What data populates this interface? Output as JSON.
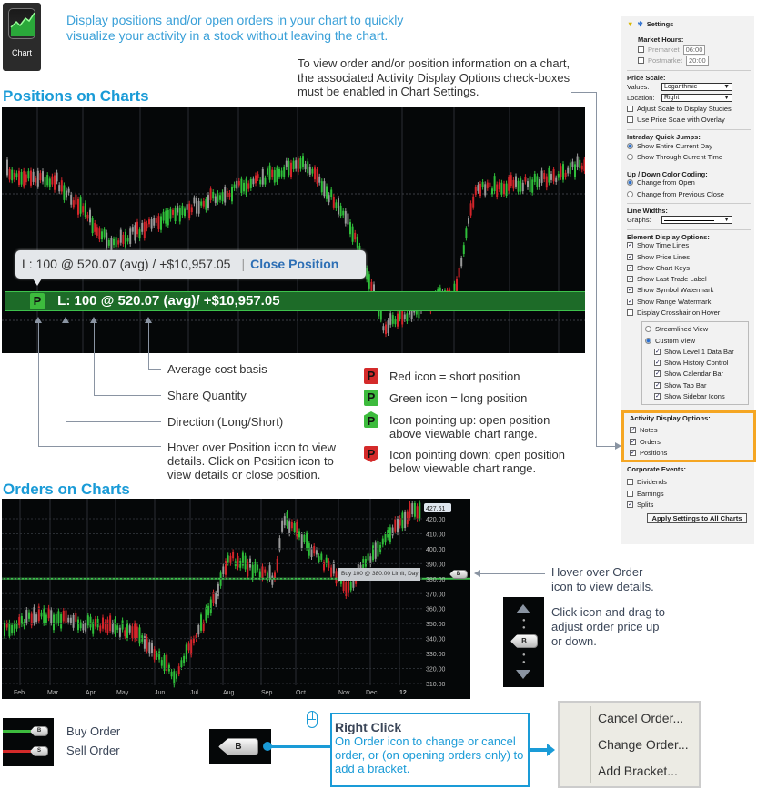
{
  "app_icon": {
    "label": "Chart"
  },
  "intro": "Display positions and/or open orders in your chart to quickly visualize your activity in a stock without leaving the chart.",
  "note": "To view order and/or position information on a chart, the associated Activity Display Options check-boxes must be enabled in Chart Settings.",
  "positions": {
    "title": "Positions on Charts",
    "tooltip": {
      "text": "L: 100 @ 520.07 (avg) / +$10,957.05",
      "separator": "|",
      "close": "Close Position"
    },
    "bar": {
      "icon": "P",
      "text": "L: 100  @ 520.07 (avg)/ +$10,957.05"
    },
    "callouts": [
      "Average cost basis",
      "Share Quantity",
      "Direction (Long/Short)",
      "Hover over Position icon to view details. Click on Position icon to view details or close position."
    ],
    "legend": [
      {
        "icon": "P",
        "color": "#d42a2a",
        "shape": "square",
        "text": "Red icon = short position"
      },
      {
        "icon": "P",
        "color": "#3dbb3d",
        "shape": "square",
        "text": "Green icon = long position"
      },
      {
        "icon": "P",
        "color": "#3dbb3d",
        "shape": "up",
        "text": "Icon pointing up: open  position above viewable chart range."
      },
      {
        "icon": "P",
        "color": "#d42a2a",
        "shape": "down",
        "text": "Icon pointing down: open position below viewable chart range."
      }
    ]
  },
  "orders": {
    "title": "Orders on Charts",
    "price_labels": [
      "427.61",
      "420.00",
      "410.00",
      "400.00",
      "390.00",
      "380.00",
      "370.00",
      "360.00",
      "350.00",
      "340.00",
      "330.00",
      "320.00",
      "310.00"
    ],
    "months": [
      "Feb",
      "Mar",
      "Apr",
      "May",
      "Jun",
      "Jul",
      "Aug",
      "Sep",
      "Oct",
      "Nov",
      "Dec",
      "12"
    ],
    "order_tooltip": "Buy 100 @ 380.00  Limit, Day",
    "order_icon": "B",
    "order_price": 380,
    "hover_note": "Hover over Order icon to view details.",
    "drag_note": "Click icon and drag to adjust order price up or down.",
    "buy_label": "Buy Order",
    "sell_label": "Sell Order",
    "buy_icon": "B",
    "sell_icon": "S",
    "right_click": {
      "title": "Right Click",
      "text": "On Order icon to change or cancel order, or (on opening orders only) to add a bracket."
    },
    "context_menu": [
      "Cancel Order...",
      "Change Order...",
      "Add Bracket..."
    ]
  },
  "settings": {
    "title": "Settings",
    "market_hours": "Market Hours:",
    "premarket": "Premarket",
    "premarket_time": "06:00",
    "postmarket": "Postmarket",
    "postmarket_time": "20:00",
    "price_scale": "Price Scale:",
    "values_label": "Values:",
    "values": "Logarithmic",
    "location_label": "Location:",
    "location": "Right",
    "adjust": "Adjust Scale to Display Studies",
    "overlay": "Use Price Scale with Overlay",
    "quick_jumps": "Intraday Quick Jumps:",
    "entire_day": "Show Entire Current Day",
    "through_time": "Show Through Current Time",
    "color_coding": "Up / Down Color Coding:",
    "from_open": "Change from Open",
    "from_close": "Change from Previous Close",
    "line_widths": "Line Widths:",
    "graphs": "Graphs:",
    "element_display": "Element Display Options:",
    "elements": [
      {
        "label": "Show Time Lines",
        "checked": true
      },
      {
        "label": "Show Price Lines",
        "checked": true
      },
      {
        "label": "Show Chart Keys",
        "checked": true
      },
      {
        "label": "Show Last Trade Label",
        "checked": true
      },
      {
        "label": "Show Symbol Watermark",
        "checked": true
      },
      {
        "label": "Show Range Watermark",
        "checked": true
      },
      {
        "label": "Display Crosshair on Hover",
        "checked": false
      }
    ],
    "streamlined": "Streamlined View",
    "custom": "Custom View",
    "custom_items": [
      "Show Level 1 Data Bar",
      "Show History Control",
      "Show Calendar Bar",
      "Show Tab Bar",
      "Show Sidebar Icons"
    ],
    "activity": "Activity Display Options:",
    "activity_items": [
      "Notes",
      "Orders",
      "Positions"
    ],
    "corporate": "Corporate Events:",
    "corporate_items": [
      {
        "label": "Dividends",
        "checked": false
      },
      {
        "label": "Earnings",
        "checked": false
      },
      {
        "label": "Splits",
        "checked": true
      }
    ],
    "apply": "Apply Settings to All Charts",
    "highlight_color": "#f5a623"
  }
}
